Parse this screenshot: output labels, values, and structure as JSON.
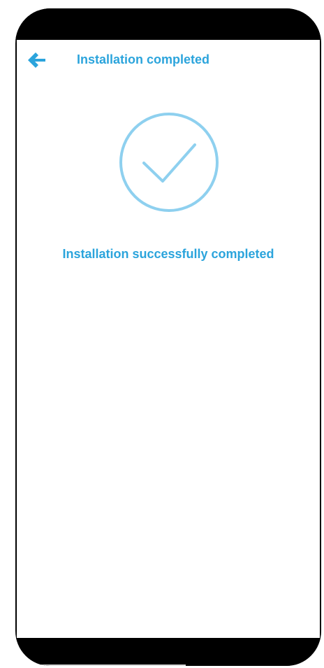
{
  "header": {
    "title": "Installation completed",
    "back_icon": "arrow-left-icon"
  },
  "status": {
    "icon": "check-circle-icon",
    "message": "Installation successfully completed"
  },
  "colors": {
    "accent": "#2ba4dc",
    "check_circle": "#8ed0ef",
    "frame": "#000000",
    "background": "#ffffff"
  }
}
